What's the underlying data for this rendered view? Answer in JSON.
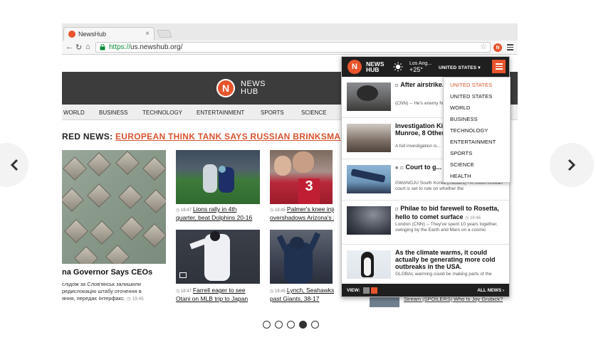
{
  "browser": {
    "tab_title": "NewsHub",
    "tab_close": "×",
    "url_scheme": "https://",
    "url_rest": "us.newshub.org/",
    "ext_letter": "N"
  },
  "site": {
    "logo_letter": "N",
    "logo_line1": "NEWS",
    "logo_line2": "HUB",
    "nav": [
      "WORLD",
      "BUSINESS",
      "TECHNOLOGY",
      "ENTERTAINMENT",
      "SPORTS",
      "SCIENCE"
    ],
    "featured_label": "RED NEWS: ",
    "featured_link": "EUROPEAN THINK TANK SAYS RUSSIAN BRINKSMANSHIP",
    "big_title": "na Governor Says CEOs",
    "big_desc": "слідом за Слов'янськ залишили\nредислокацію штабу оточення в\nяння, передає Інтерфакс.",
    "big_time": "◷ 19:45",
    "thumbs": [
      {
        "time": "◷ 18:47",
        "line1": "Lions rally in 4th",
        "line2": "quarter, beat Dolphins 20-16"
      },
      {
        "time": "◷ 19:45",
        "line1": "Palmer's knee inju",
        "line2": "overshadows Arizona's 26"
      },
      {
        "time": "◷ 18:47",
        "line1": "Farrell eager to see",
        "line2": "Otani on MLB trip to Japan"
      },
      {
        "time": "◷ 19:45",
        "line1": "Lynch, Seahawks r",
        "line2": "past Giants, 38-17"
      }
    ],
    "small_story": "Stream [SPOILERS] Who Is Joy Grubick?"
  },
  "popup": {
    "logo_letter": "N",
    "name_line1": "NEWS",
    "name_line2": "HUB",
    "weather_city": "Los Ang...",
    "weather_temp": "+25°",
    "region": "UNITED STATES ▾",
    "stories": [
      {
        "title": "After airstrike... over fate of ISIS",
        "summary": "(CNN) -- He's enemy No... ISIS. But after waves o..."
      },
      {
        "title": "Investigation Killed Prominen... Munroe, 8 Other...",
        "summary": "A full investigation is..."
      },
      {
        "title": "Court to g... doomed South K...",
        "summary": "GWANGJU South Korea (Reuters) - A South Korean court is set to rule on whether the"
      },
      {
        "title": "Philae to bid farewell to Rosetta, hello to comet surface",
        "time": "◷ 19:46",
        "summary": "London (CNN) -- They've spent 10 years together, swinging by the Earth and Mars on a cosmic"
      },
      {
        "title": "As the climate warms, it could actually be generating more cold outbreaks in the USA.",
        "summary": "GLOBAL warming could be making parts of the"
      }
    ],
    "view_label": "VIEW:",
    "all_news": "ALL NEWS ›"
  },
  "dropdown": {
    "items": [
      "UNITED STATES",
      "UNITED STATES",
      "WORLD",
      "BUSINESS",
      "TECHNOLOGY",
      "ENTERTAINMENT",
      "SPORTS",
      "SCIENCE",
      "HEALTH"
    ]
  },
  "colors": {
    "accent": "#e8542c",
    "dark": "#1f1f1f",
    "link": "#d9532f"
  }
}
